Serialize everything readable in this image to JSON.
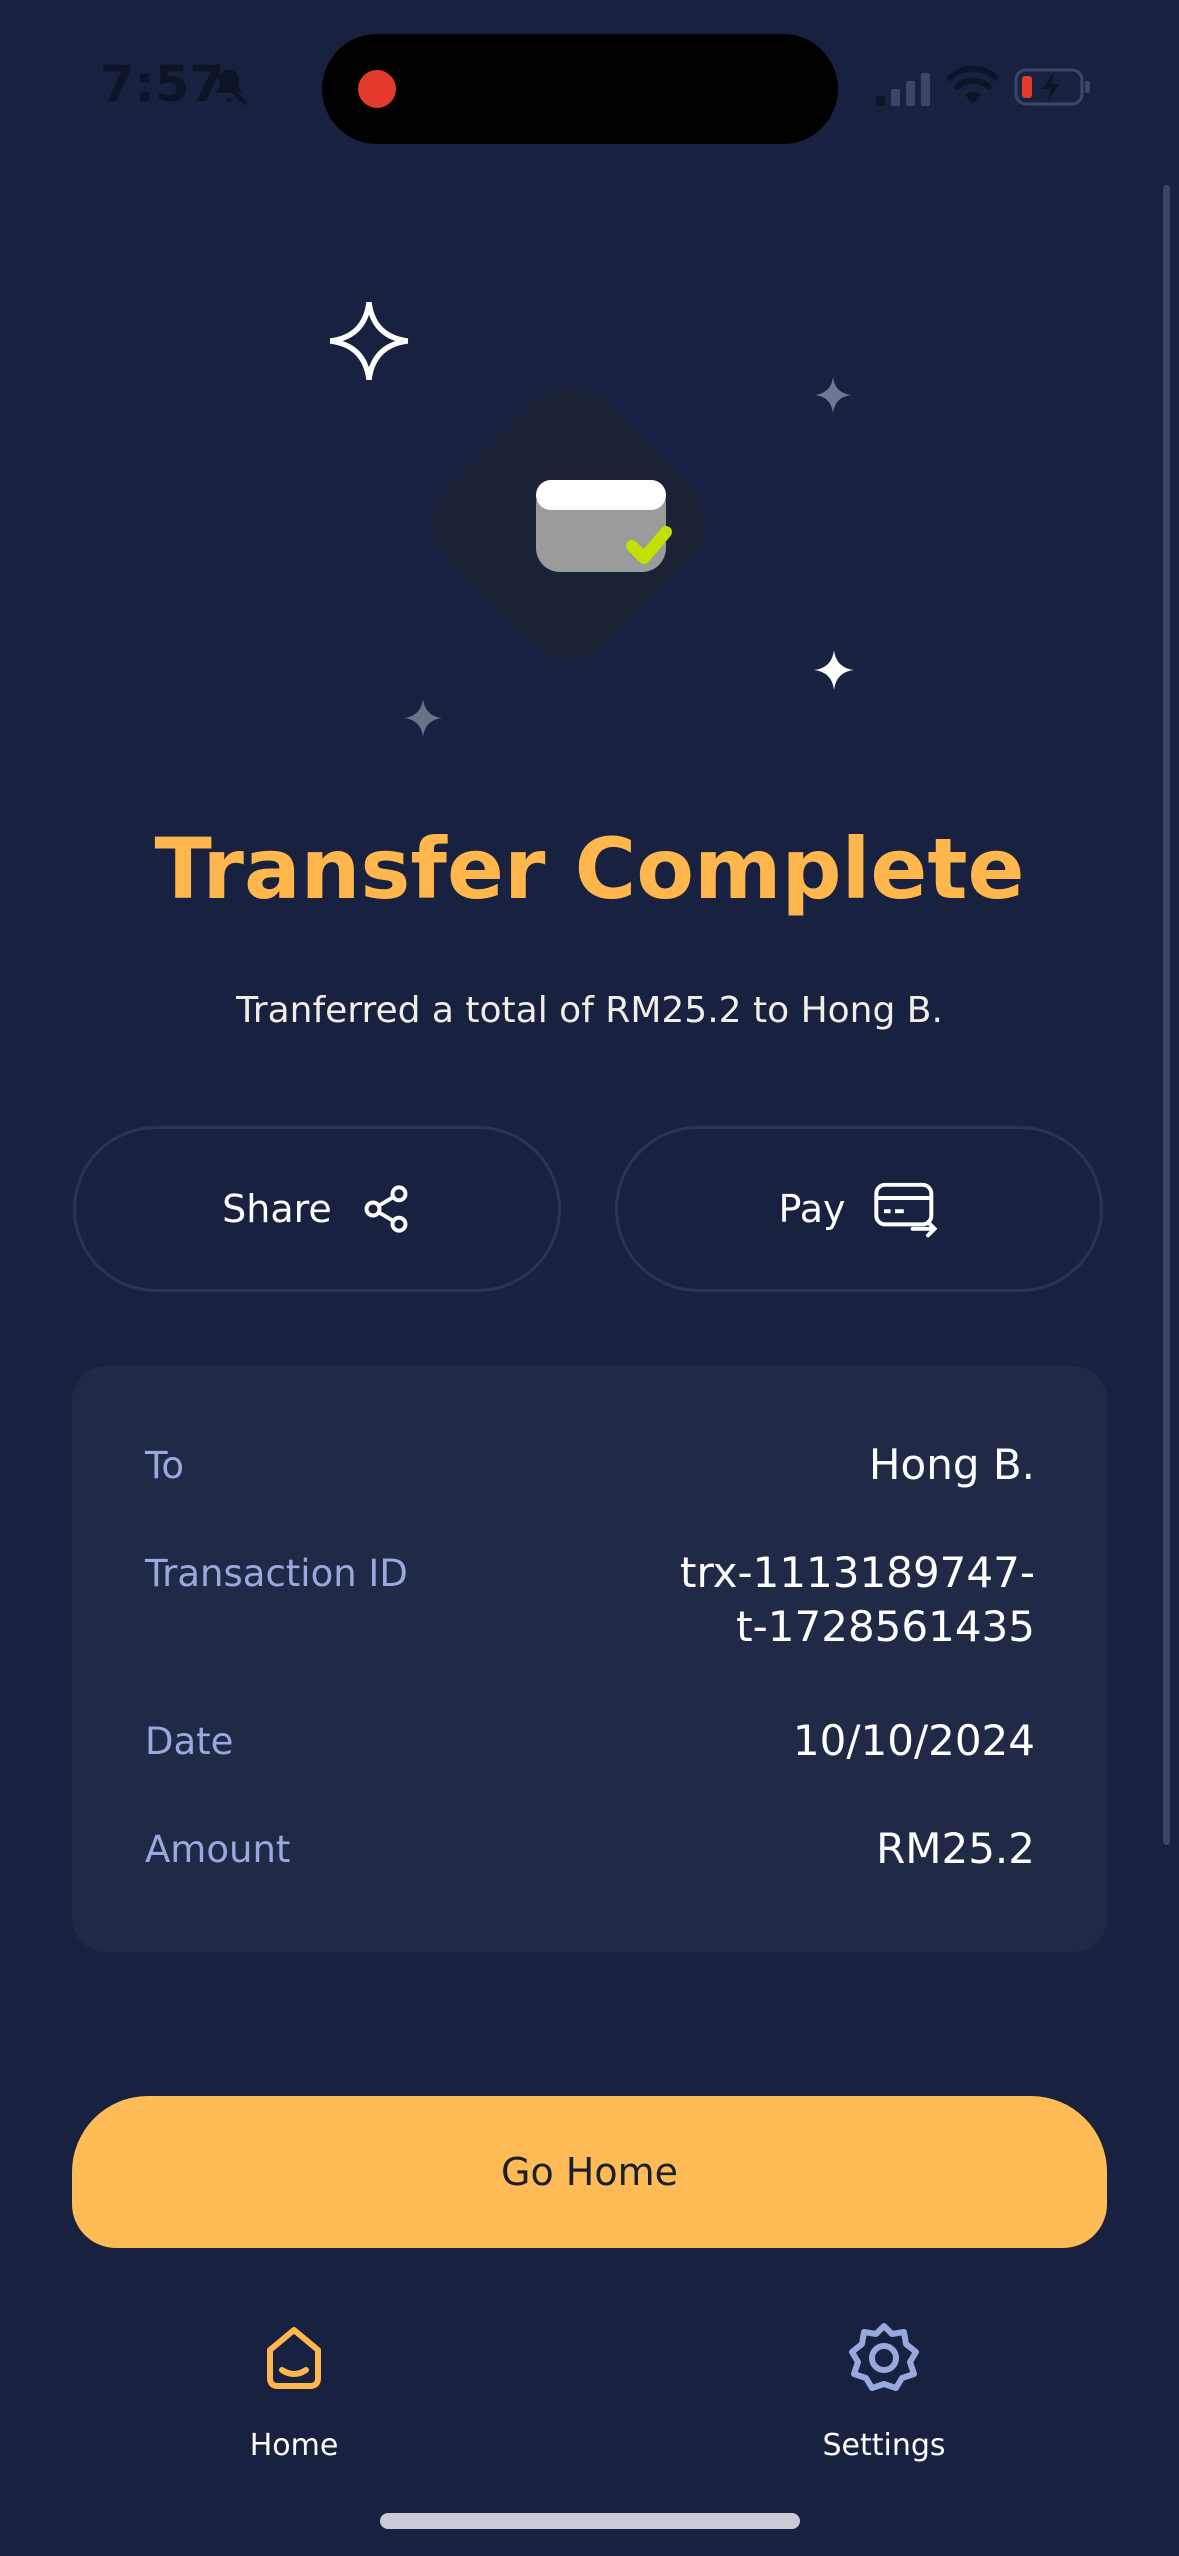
{
  "status_bar": {
    "time": "7:57",
    "icons": [
      "bell-muted-icon",
      "signal-icon",
      "wifi-icon",
      "battery-charging-icon"
    ]
  },
  "hero": {
    "icons": [
      "sparkle-icon",
      "card-check-icon"
    ]
  },
  "title": "Transfer Complete",
  "subtitle": "Tranferred a total of RM25.2 to Hong B.",
  "actions": {
    "share_label": "Share",
    "share_icon": "share-icon",
    "pay_label": "Pay",
    "pay_icon": "card-transfer-icon"
  },
  "details": {
    "to_label": "To",
    "to_value": "Hong B.",
    "transaction_label": "Transaction ID",
    "transaction_value_line1": "trx-1113189747-",
    "transaction_value_line2": "t-1728561435",
    "date_label": "Date",
    "date_value": "10/10/2024",
    "amount_label": "Amount",
    "amount_value": "RM25.2"
  },
  "go_home_label": "Go Home",
  "nav": {
    "home_label": "Home",
    "settings_label": "Settings"
  },
  "colors": {
    "background": "#182240",
    "accent": "#ffb74d",
    "card": "#202a47",
    "label": "#9aa8de"
  }
}
